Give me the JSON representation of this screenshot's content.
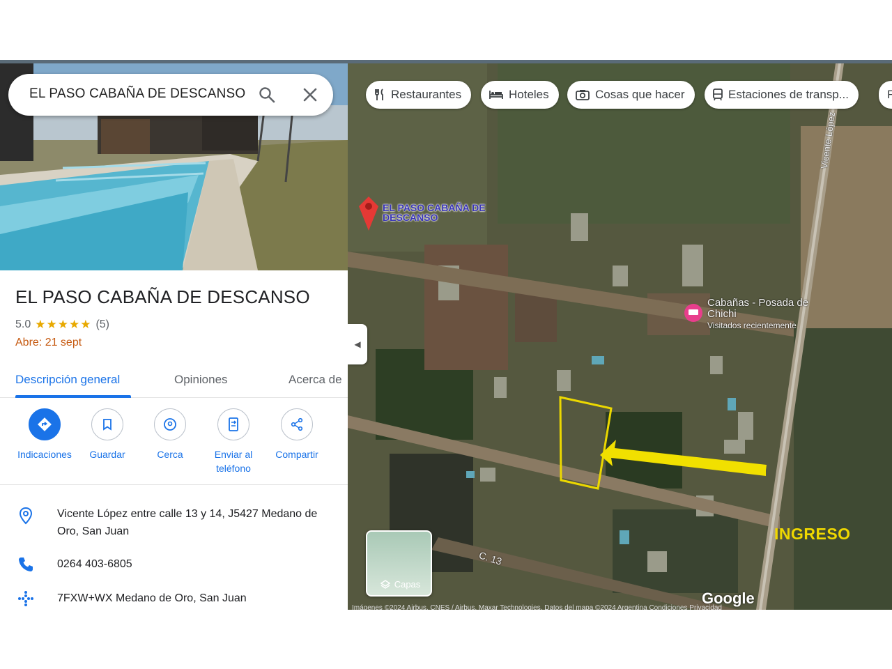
{
  "search": {
    "query": "EL PASO CABAÑA DE DESCANSO"
  },
  "place": {
    "title": "EL PASO CABAÑA DE DESCANSO",
    "rating": "5.0",
    "stars": "★★★★★",
    "review_count": "(5)",
    "open_status": "Abre: 21 sept"
  },
  "tabs": [
    {
      "label": "Descripción general"
    },
    {
      "label": "Opiniones"
    },
    {
      "label": "Acerca de"
    }
  ],
  "actions": [
    {
      "label": "Indicaciones",
      "icon": "directions-icon"
    },
    {
      "label": "Guardar",
      "icon": "bookmark-icon"
    },
    {
      "label": "Cerca",
      "icon": "nearby-icon"
    },
    {
      "label": "Enviar al teléfono",
      "icon": "send-to-phone-icon"
    },
    {
      "label": "Compartir",
      "icon": "share-icon"
    }
  ],
  "info": {
    "address": "Vicente López entre calle 13 y 14, J5427 Medano de Oro, San Juan",
    "phone": "0264 403-6805",
    "plus_code": "7FXW+WX Medano de Oro, San Juan"
  },
  "map": {
    "chips": [
      {
        "label": "Restaurantes",
        "icon": "restaurant-icon"
      },
      {
        "label": "Hoteles",
        "icon": "hotel-icon"
      },
      {
        "label": "Cosas que hacer",
        "icon": "camera-icon"
      },
      {
        "label": "Estaciones de transp...",
        "icon": "transit-icon"
      },
      {
        "label": "F",
        "icon": ""
      }
    ],
    "marker_label": "EL PASO CABAÑA DE DESCANSO",
    "poi_name": "Cabañas - Posada de Chichi",
    "poi_sub": "Visitados recientemente",
    "road_vertical": "Vicente López",
    "road_bottom": "C. 13",
    "annotation": "INGRESO",
    "layers_label": "Capas",
    "logo": "Google",
    "attribution": "Imágenes ©2024 Airbus, CNES / Airbus, Maxar Technologies, Datos del mapa ©2024    Argentina    Condiciones    Privacidad"
  },
  "colors": {
    "accent": "#1a73e8",
    "star": "#e8a900",
    "open_status": "#c65a11",
    "marker": "#e53935",
    "annotation": "#f0d800"
  }
}
